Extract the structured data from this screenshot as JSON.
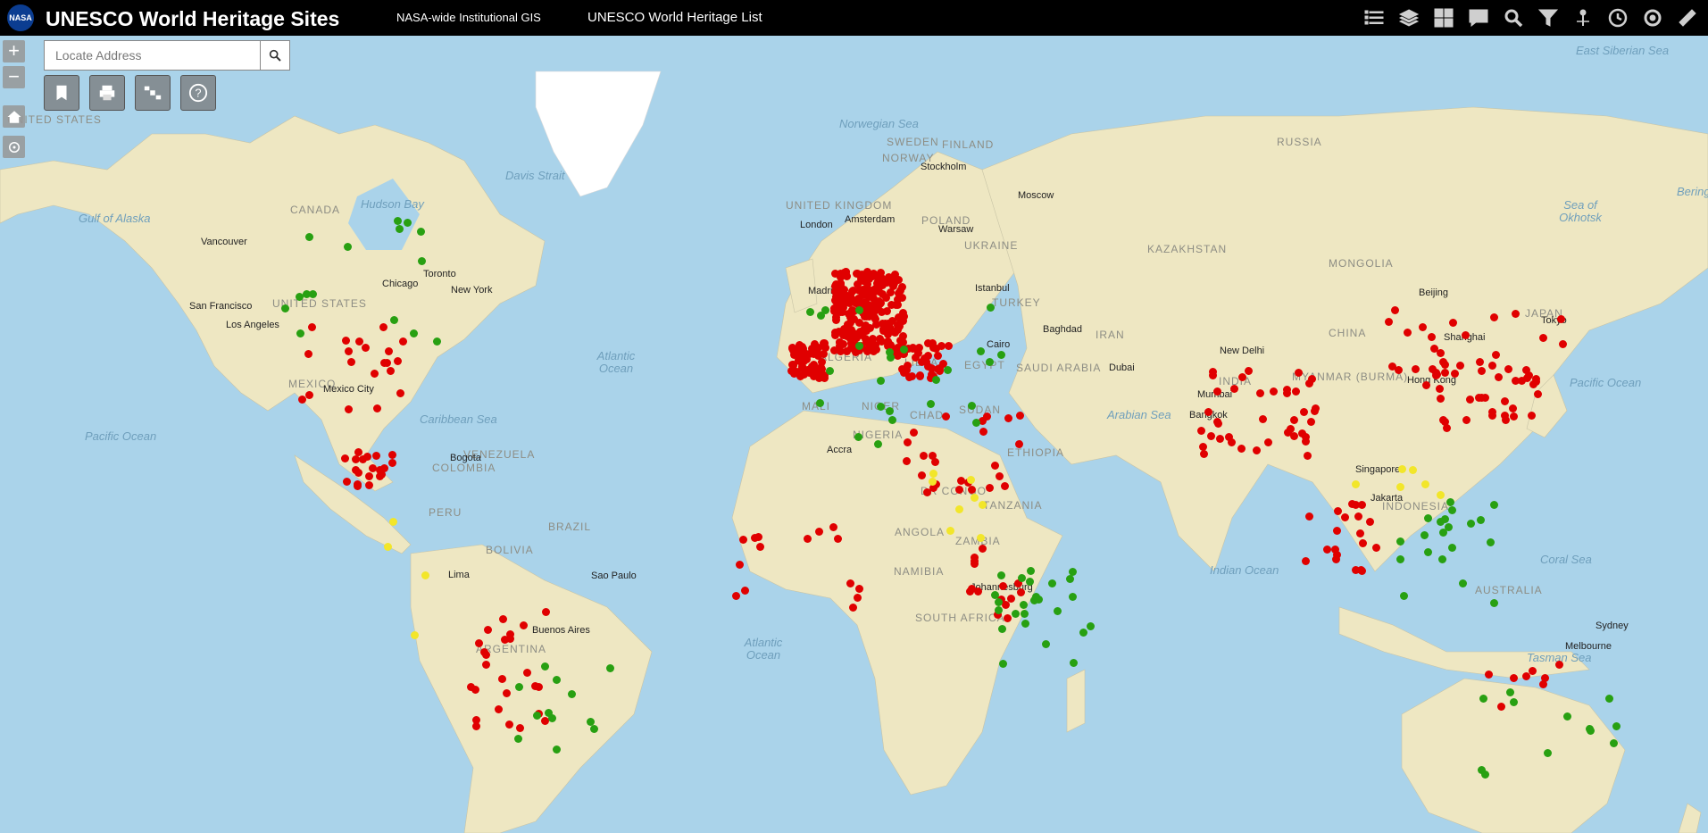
{
  "header": {
    "logo_text": "NASA",
    "title": "UNESCO World Heritage Sites",
    "link1": "NASA-wide Institutional GIS",
    "link2": "UNESCO World Heritage List"
  },
  "toolbar": {
    "icons": [
      "list-icon",
      "layers-icon",
      "grid-icon",
      "comment-icon",
      "search-icon",
      "filter-icon",
      "pin-icon",
      "history-icon",
      "settings-icon",
      "measure-icon"
    ]
  },
  "search": {
    "placeholder": "Locate Address"
  },
  "map_tools": {
    "icons": [
      "bookmark-icon",
      "print-icon",
      "satellite-icon",
      "help-icon"
    ]
  },
  "colors": {
    "red": "#e00000",
    "green": "#28a012",
    "yellow": "#f2e62a",
    "land": "#eee7c2",
    "ocean": "#aad3ea"
  },
  "ocean_labels": [
    {
      "name": "Norwegian Sea"
    },
    {
      "name": "Davis Strait"
    },
    {
      "name": "Hudson Bay"
    },
    {
      "name": "Gulf of Alaska"
    },
    {
      "name": "Atlantic Ocean"
    },
    {
      "name": "Pacific Ocean"
    },
    {
      "name": "Caribbean Sea"
    },
    {
      "name": "Arabian Sea"
    },
    {
      "name": "Indian Ocean"
    },
    {
      "name": "Pacific Ocean"
    },
    {
      "name": "Atlantic Ocean"
    },
    {
      "name": "Sea of Okhotsk"
    },
    {
      "name": "Coral Sea"
    },
    {
      "name": "Tasman Sea"
    },
    {
      "name": "East Siberian Sea"
    },
    {
      "name": "Bering"
    }
  ],
  "country_labels": [
    "CANADA",
    "UNITED STATES",
    "MEXICO",
    "VENEZUELA",
    "COLOMBIA",
    "PERU",
    "BRAZIL",
    "BOLIVIA",
    "ARGENTINA",
    "ALGERIA",
    "LIBYA",
    "EGYPT",
    "MALI",
    "NIGER",
    "CHAD",
    "SUDAN",
    "NIGERIA",
    "ETHIOPIA",
    "DR CONGO",
    "TANZANIA",
    "ANGOLA",
    "ZAMBIA",
    "NAMIBIA",
    "SOUTH AFRICA",
    "RUSSIA",
    "KAZAKHSTAN",
    "MONGOLIA",
    "CHINA",
    "INDIA",
    "IRAN",
    "TURKEY",
    "SAUDI ARABIA",
    "SWEDEN",
    "FINLAND",
    "NORWAY",
    "UKRAINE",
    "POLAND",
    "INDONESIA",
    "AUSTRALIA",
    "MYANMAR (BURMA)",
    "UNITED KINGDOM",
    "JAPAN",
    "UNITED STATES"
  ],
  "city_labels": [
    "Vancouver",
    "San Francisco",
    "Los Angeles",
    "Chicago",
    "Toronto",
    "New York",
    "Mexico City",
    "Bogota",
    "Lima",
    "Sao Paulo",
    "Buenos Aires",
    "London",
    "Amsterdam",
    "Warsaw",
    "Stockholm",
    "Moscow",
    "Madrid",
    "Istanbul",
    "Cairo",
    "Baghdad",
    "Dubai",
    "Mumbai",
    "New Delhi",
    "Bangkok",
    "Singapore",
    "Jakarta",
    "Hong Kong",
    "Shanghai",
    "Beijing",
    "Tokyo",
    "Accra",
    "Johannesburg",
    "Sydney",
    "Melbourne"
  ]
}
